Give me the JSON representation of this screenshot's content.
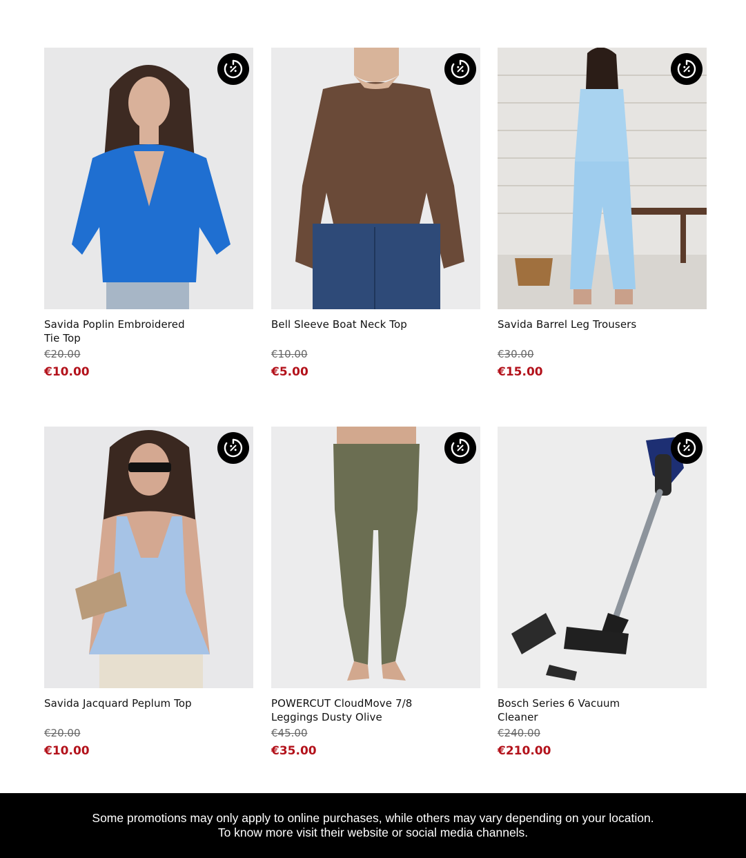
{
  "products": [
    {
      "title": "Savida Poplin Embroidered Tie Top",
      "old_price": "€20.00",
      "new_price": "€10.00",
      "badge_icon": "promo-percent-icon"
    },
    {
      "title": "Bell Sleeve Boat Neck Top",
      "old_price": "€10.00",
      "new_price": "€5.00",
      "badge_icon": "promo-percent-icon"
    },
    {
      "title": "Savida Barrel Leg Trousers",
      "old_price": "€30.00",
      "new_price": "€15.00",
      "badge_icon": "promo-percent-icon"
    },
    {
      "title": "Savida Jacquard Peplum Top",
      "old_price": "€20.00",
      "new_price": "€10.00",
      "badge_icon": "promo-percent-icon"
    },
    {
      "title": "POWERCUT CloudMove 7/8 Leggings Dusty Olive",
      "old_price": "€45.00",
      "new_price": "€35.00",
      "badge_icon": "promo-percent-icon"
    },
    {
      "title": "Bosch Series 6 Vacuum Cleaner",
      "old_price": "€240.00",
      "new_price": "€210.00",
      "badge_icon": "promo-percent-icon"
    }
  ],
  "footer": {
    "line1": "Some promotions may only apply to online purchases, while others may vary depending on your location.",
    "line2": "To know more visit their website or social media channels."
  },
  "colors": {
    "sale_price": "#b3121b",
    "badge_bg": "#000000",
    "footer_bg": "#000000"
  }
}
